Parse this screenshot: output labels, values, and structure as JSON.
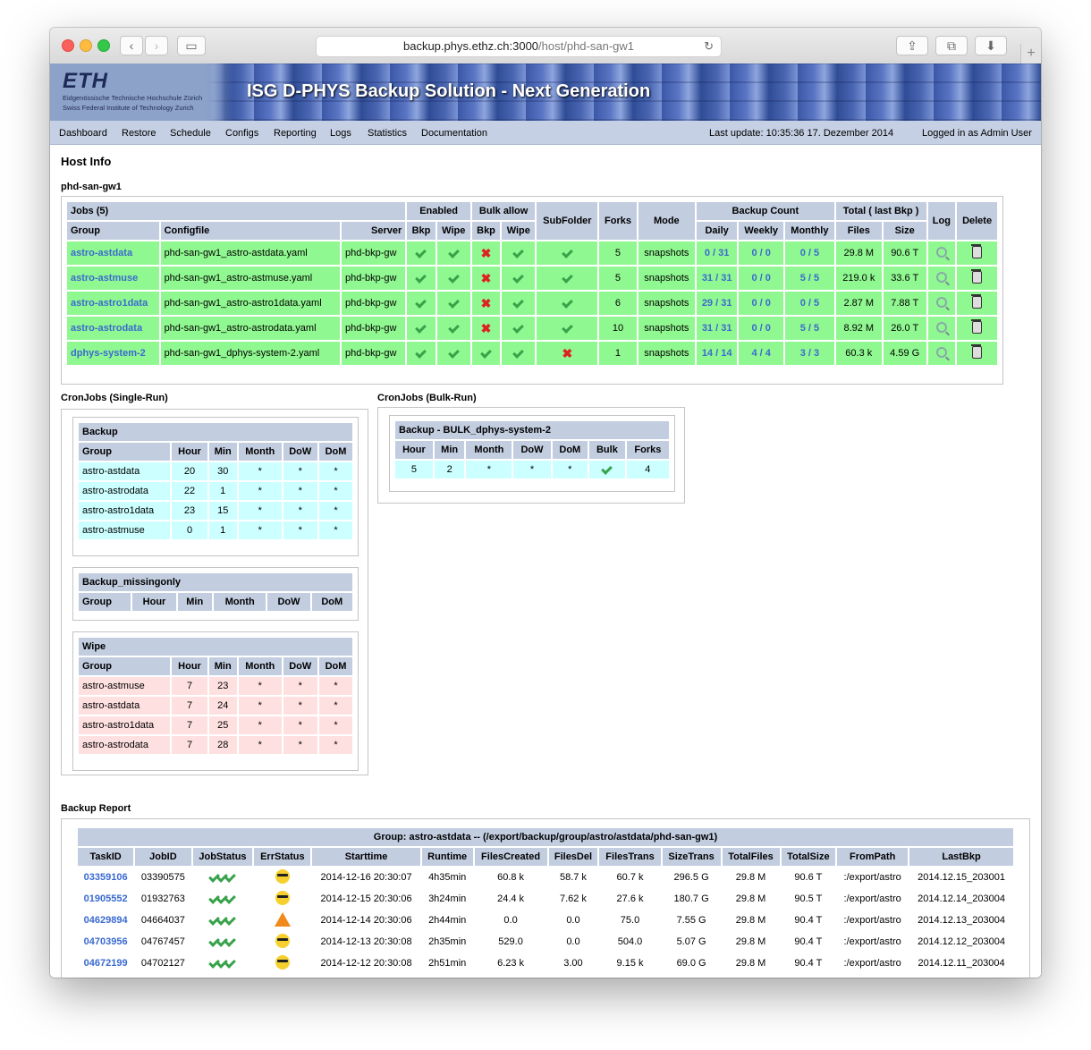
{
  "browser": {
    "url_host": "backup.phys.ethz.ch:3000",
    "url_path": "/host/phd-san-gw1"
  },
  "banner": {
    "logo": "ETH",
    "line1": "Eidgenössische Technische Hochschule Zürich",
    "line2": "Swiss Federal Institute of Technology Zurich",
    "title": "ISG D-PHYS Backup Solution - Next Generation"
  },
  "menu": {
    "items": [
      "Dashboard",
      "Restore",
      "Schedule",
      "Configs",
      "Reporting",
      "Logs",
      "Statistics",
      "Documentation"
    ],
    "last_update": "Last update: 10:35:36 17. Dezember 2014",
    "login": "Logged in as Admin User"
  },
  "page": {
    "title": "Host Info",
    "host": "phd-san-gw1"
  },
  "jobs": {
    "caption": "Jobs (5)",
    "group_headers": {
      "enabled": "Enabled",
      "bulk": "Bulk allow",
      "count": "Backup Count",
      "total": "Total ( last Bkp )"
    },
    "headers": [
      "Group",
      "Configfile",
      "Server",
      "Bkp",
      "Wipe",
      "Bkp",
      "Wipe",
      "SubFolder",
      "Forks",
      "Mode",
      "Daily",
      "Weekly",
      "Monthly",
      "Files",
      "Size",
      "Log",
      "Delete"
    ],
    "rows": [
      {
        "group": "astro-astdata",
        "config": "phd-san-gw1_astro-astdata.yaml",
        "server": "phd-bkp-gw",
        "en_bkp": true,
        "en_wipe": true,
        "bulk_bkp": false,
        "bulk_wipe": true,
        "subfolder": true,
        "forks": "5",
        "mode": "snapshots",
        "daily": "0 / 31",
        "weekly": "0 / 0",
        "monthly": "0 / 5",
        "files": "29.8 M",
        "size": "90.6 T"
      },
      {
        "group": "astro-astmuse",
        "config": "phd-san-gw1_astro-astmuse.yaml",
        "server": "phd-bkp-gw",
        "en_bkp": true,
        "en_wipe": true,
        "bulk_bkp": false,
        "bulk_wipe": true,
        "subfolder": true,
        "forks": "5",
        "mode": "snapshots",
        "daily": "31 / 31",
        "weekly": "0 / 0",
        "monthly": "5 / 5",
        "files": "219.0 k",
        "size": "33.6 T"
      },
      {
        "group": "astro-astro1data",
        "config": "phd-san-gw1_astro-astro1data.yaml",
        "server": "phd-bkp-gw",
        "en_bkp": true,
        "en_wipe": true,
        "bulk_bkp": false,
        "bulk_wipe": true,
        "subfolder": true,
        "forks": "6",
        "mode": "snapshots",
        "daily": "29 / 31",
        "weekly": "0 / 0",
        "monthly": "0 / 5",
        "files": "2.87 M",
        "size": "7.88 T"
      },
      {
        "group": "astro-astrodata",
        "config": "phd-san-gw1_astro-astrodata.yaml",
        "server": "phd-bkp-gw",
        "en_bkp": true,
        "en_wipe": true,
        "bulk_bkp": false,
        "bulk_wipe": true,
        "subfolder": true,
        "forks": "10",
        "mode": "snapshots",
        "daily": "31 / 31",
        "weekly": "0 / 0",
        "monthly": "5 / 5",
        "files": "8.92 M",
        "size": "26.0 T"
      },
      {
        "group": "dphys-system-2",
        "config": "phd-san-gw1_dphys-system-2.yaml",
        "server": "phd-bkp-gw",
        "en_bkp": true,
        "en_wipe": true,
        "bulk_bkp": true,
        "bulk_wipe": true,
        "subfolder": false,
        "forks": "1",
        "mode": "snapshots",
        "daily": "14 / 14",
        "weekly": "4 / 4",
        "monthly": "3 / 3",
        "files": "60.3 k",
        "size": "4.59 G"
      }
    ]
  },
  "cron_single": {
    "title": "CronJobs (Single-Run)",
    "backup": {
      "caption": "Backup",
      "headers": [
        "Group",
        "Hour",
        "Min",
        "Month",
        "DoW",
        "DoM"
      ],
      "rows": [
        [
          "astro-astdata",
          "20",
          "30",
          "*",
          "*",
          "*"
        ],
        [
          "astro-astrodata",
          "22",
          "1",
          "*",
          "*",
          "*"
        ],
        [
          "astro-astro1data",
          "23",
          "15",
          "*",
          "*",
          "*"
        ],
        [
          "astro-astmuse",
          "0",
          "1",
          "*",
          "*",
          "*"
        ]
      ]
    },
    "missing": {
      "caption": "Backup_missingonly",
      "headers": [
        "Group",
        "Hour",
        "Min",
        "Month",
        "DoW",
        "DoM"
      ]
    },
    "wipe": {
      "caption": "Wipe",
      "headers": [
        "Group",
        "Hour",
        "Min",
        "Month",
        "DoW",
        "DoM"
      ],
      "rows": [
        [
          "astro-astmuse",
          "7",
          "23",
          "*",
          "*",
          "*"
        ],
        [
          "astro-astdata",
          "7",
          "24",
          "*",
          "*",
          "*"
        ],
        [
          "astro-astro1data",
          "7",
          "25",
          "*",
          "*",
          "*"
        ],
        [
          "astro-astrodata",
          "7",
          "28",
          "*",
          "*",
          "*"
        ]
      ]
    }
  },
  "cron_bulk": {
    "title": "CronJobs (Bulk-Run)",
    "caption": "Backup - BULK_dphys-system-2",
    "headers": [
      "Hour",
      "Min",
      "Month",
      "DoW",
      "DoM",
      "Bulk",
      "Forks"
    ],
    "row": [
      "5",
      "2",
      "*",
      "*",
      "*",
      "check",
      "4"
    ]
  },
  "report": {
    "title": "Backup Report",
    "caption": "Group: astro-astdata -- (/export/backup/group/astro/astdata/phd-san-gw1)",
    "headers": [
      "TaskID",
      "JobID",
      "JobStatus",
      "ErrStatus",
      "Starttime",
      "Runtime",
      "FilesCreated",
      "FilesDel",
      "FilesTrans",
      "SizeTrans",
      "TotalFiles",
      "TotalSize",
      "FromPath",
      "LastBkp"
    ],
    "rows": [
      {
        "task": "03359106",
        "job": "03390575",
        "err": "ok",
        "start": "2014-12-16 20:30:07",
        "runtime": "4h35min",
        "created": "60.8 k",
        "del": "58.7 k",
        "trans": "60.7 k",
        "sizetrans": "296.5 G",
        "totalfiles": "29.8 M",
        "totalsize": "90.6 T",
        "from": ":/export/astro",
        "last": "2014.12.15_203001"
      },
      {
        "task": "01905552",
        "job": "01932763",
        "err": "ok",
        "start": "2014-12-15 20:30:06",
        "runtime": "3h24min",
        "created": "24.4 k",
        "del": "7.62 k",
        "trans": "27.6 k",
        "sizetrans": "180.7 G",
        "totalfiles": "29.8 M",
        "totalsize": "90.5 T",
        "from": ":/export/astro",
        "last": "2014.12.14_203004"
      },
      {
        "task": "04629894",
        "job": "04664037",
        "err": "warn",
        "start": "2014-12-14 20:30:06",
        "runtime": "2h44min",
        "created": "0.0",
        "del": "0.0",
        "trans": "75.0",
        "sizetrans": "7.55 G",
        "totalfiles": "29.8 M",
        "totalsize": "90.4 T",
        "from": ":/export/astro",
        "last": "2014.12.13_203004"
      },
      {
        "task": "04703956",
        "job": "04767457",
        "err": "ok",
        "start": "2014-12-13 20:30:08",
        "runtime": "2h35min",
        "created": "529.0",
        "del": "0.0",
        "trans": "504.0",
        "sizetrans": "5.07 G",
        "totalfiles": "29.8 M",
        "totalsize": "90.4 T",
        "from": ":/export/astro",
        "last": "2014.12.12_203004"
      },
      {
        "task": "04672199",
        "job": "04702127",
        "err": "ok",
        "start": "2014-12-12 20:30:08",
        "runtime": "2h51min",
        "created": "6.23 k",
        "del": "3.00",
        "trans": "9.15 k",
        "sizetrans": "69.0 G",
        "totalfiles": "29.8 M",
        "totalsize": "90.4 T",
        "from": ":/export/astro",
        "last": "2014.12.11_203004"
      }
    ]
  }
}
